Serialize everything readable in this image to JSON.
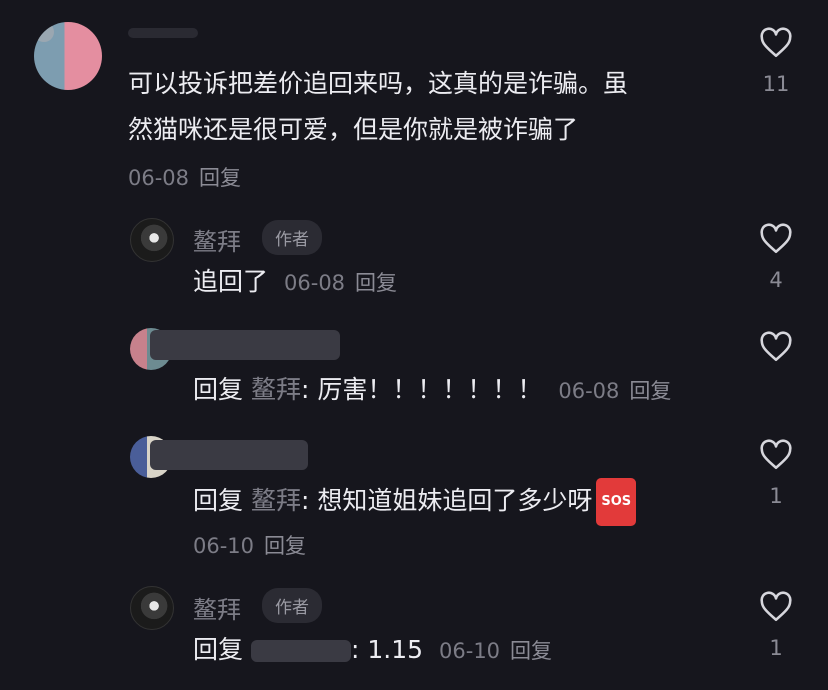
{
  "comments": [
    {
      "text_line1": "可以投诉把差价追回来吗，这真的是诈骗。虽",
      "text_line2": "然猫咪还是很可爱，但是你就是被诈骗了",
      "date": "06-08",
      "reply_label": "回复",
      "likes": "11"
    }
  ],
  "replies": [
    {
      "author": "鳌拜",
      "badge": "作者",
      "text": "追回了",
      "date": "06-08",
      "reply_label": "回复",
      "likes": "4"
    },
    {
      "prefix": "回复",
      "mention": "鳌拜",
      "colon": ":",
      "text": " 厉害！！！！！！！",
      "date": "06-08",
      "reply_label": "回复",
      "likes": ""
    },
    {
      "prefix": "回复",
      "mention": "鳌拜",
      "colon": ":",
      "text": " 想知道姐妹追回了多少呀",
      "sos": "SOS",
      "date": "06-10",
      "reply_label": "回复",
      "likes": "1"
    },
    {
      "author": "鳌拜",
      "badge": "作者",
      "prefix": "回复",
      "text": ": 1.15",
      "date": "06-10",
      "reply_label": "回复",
      "likes": "1"
    }
  ],
  "icons": {
    "like": "heart-outline-icon",
    "avatar": "user-avatar"
  },
  "colors": {
    "background": "#16161d",
    "text": "#ececf1",
    "muted": "#7c7c86",
    "sos": "#e23a3a"
  }
}
